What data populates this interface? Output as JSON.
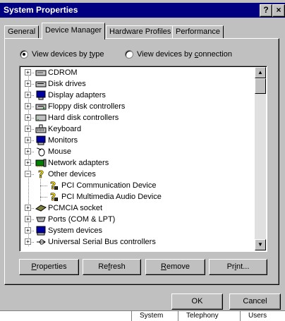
{
  "window": {
    "title": "System Properties",
    "help_button": "?",
    "close_button": "×"
  },
  "tabs": [
    {
      "label": "General",
      "active": false
    },
    {
      "label": "Device Manager",
      "active": true
    },
    {
      "label": "Hardware Profiles",
      "active": false
    },
    {
      "label": "Performance",
      "active": false
    }
  ],
  "view_options": {
    "by_type": {
      "pre": "View devices by ",
      "u": "t",
      "post": "ype",
      "selected": true
    },
    "by_connection": {
      "pre": "View devices by ",
      "u": "c",
      "post": "onnection",
      "selected": false
    }
  },
  "devices": [
    {
      "label": "CDROM",
      "icon": "cdrom-icon",
      "expander": "+"
    },
    {
      "label": "Disk drives",
      "icon": "disk-drive-icon",
      "expander": "+"
    },
    {
      "label": "Display adapters",
      "icon": "display-adapter-icon",
      "expander": "+"
    },
    {
      "label": "Floppy disk controllers",
      "icon": "floppy-controller-icon",
      "expander": "+"
    },
    {
      "label": "Hard disk controllers",
      "icon": "hard-disk-controller-icon",
      "expander": "+"
    },
    {
      "label": "Keyboard",
      "icon": "keyboard-icon",
      "expander": "+"
    },
    {
      "label": "Monitors",
      "icon": "monitor-icon",
      "expander": "+"
    },
    {
      "label": "Mouse",
      "icon": "mouse-icon",
      "expander": "+"
    },
    {
      "label": "Network adapters",
      "icon": "network-adapter-icon",
      "expander": "+"
    },
    {
      "label": "Other devices",
      "icon": "question-icon",
      "expander": "−"
    },
    {
      "label": "PCI Communication Device",
      "icon": "unknown-device-icon",
      "child": true
    },
    {
      "label": "PCI Multimedia Audio Device",
      "icon": "unknown-device-icon",
      "child": true
    },
    {
      "label": "PCMCIA socket",
      "icon": "pcmcia-icon",
      "expander": "+"
    },
    {
      "label": "Ports (COM & LPT)",
      "icon": "port-icon",
      "expander": "+"
    },
    {
      "label": "System devices",
      "icon": "system-device-icon",
      "expander": "+"
    },
    {
      "label": "Universal Serial Bus controllers",
      "icon": "usb-icon",
      "expander": "+"
    }
  ],
  "buttons": {
    "properties": {
      "pre": "",
      "u": "P",
      "post": "roperties"
    },
    "refresh": {
      "pre": "Re",
      "u": "f",
      "post": "resh"
    },
    "remove": {
      "pre": "",
      "u": "R",
      "post": "emove"
    },
    "print": {
      "pre": "Pr",
      "u": "i",
      "post": "nt..."
    },
    "ok": "OK",
    "cancel": "Cancel"
  },
  "scroll": {
    "up": "▲",
    "down": "▼"
  },
  "background_strip": [
    "System",
    "Telephony",
    "Users"
  ],
  "colors": {
    "titlebar": "#000080",
    "face": "#c0c0c0",
    "highlight": "#ffffff",
    "shadow": "#808080"
  }
}
